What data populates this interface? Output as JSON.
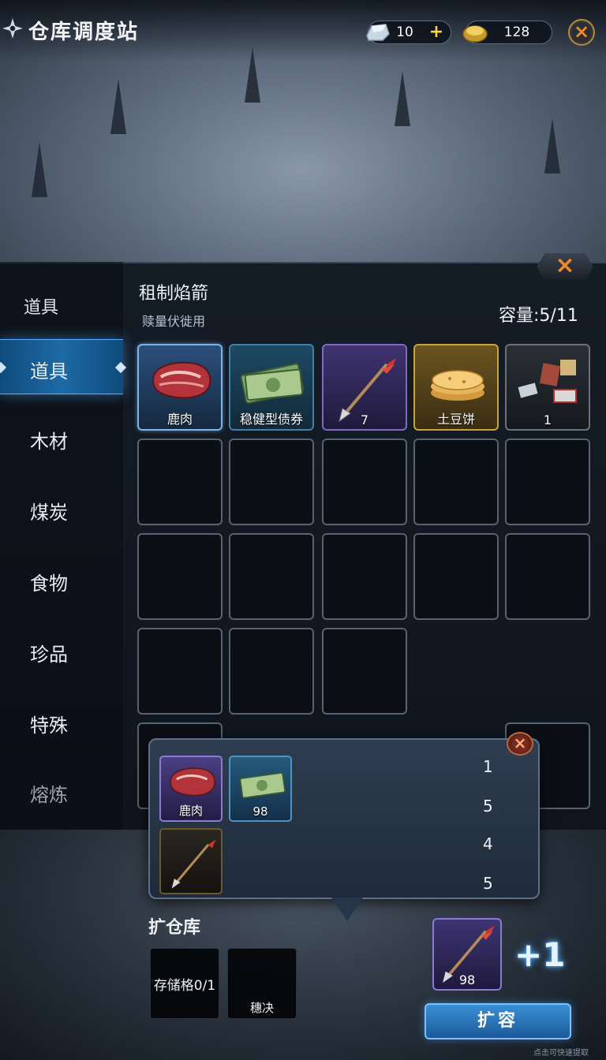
{
  "header": {
    "title": "仓库调度站",
    "currency_silver": {
      "icon": "silver-ingot-icon",
      "amount": "10",
      "plus": "+"
    },
    "currency_gold": {
      "icon": "gold-ingot-icon",
      "amount": "128"
    },
    "close": "×"
  },
  "panel": {
    "close": "×"
  },
  "sidebar": {
    "header": "道具",
    "items": [
      {
        "label": "道具",
        "active": true
      },
      {
        "label": "木材"
      },
      {
        "label": "煤炭"
      },
      {
        "label": "食物"
      },
      {
        "label": "珍品"
      },
      {
        "label": "特殊"
      },
      {
        "label": "熔炼"
      }
    ]
  },
  "grid": {
    "title": "租制焰箭",
    "subtitle": "赎量伏徙用",
    "capacity": "容量:5/11",
    "items": [
      {
        "icon": "raw-meat-icon",
        "qty": "鹿肉"
      },
      {
        "icon": "cash-banknotes-icon",
        "qty": "稳健型债券"
      },
      {
        "icon": "fire-arrow-icon",
        "qty": "7"
      },
      {
        "icon": "potato-pancake-icon",
        "qty": "土豆饼"
      },
      {
        "icon": "supply-bundle-icon",
        "qty": "1"
      }
    ]
  },
  "popup": {
    "close": "×",
    "items": [
      {
        "icon": "raw-meat-icon",
        "qty": "鹿肉"
      },
      {
        "icon": "cash-banknotes-icon",
        "qty": "98"
      },
      {
        "icon": "fire-arrow-icon",
        "qty": ""
      }
    ],
    "numbers": [
      "1",
      "5",
      "4",
      "5"
    ]
  },
  "expand": {
    "title": "扩仓库",
    "slot1": "存储格0/1",
    "slot2": "穗决",
    "reward_icon": "fire-arrow-icon",
    "reward_qty": "98",
    "bonus": "+1",
    "button": "扩容",
    "footer": "点击可快速提取"
  }
}
